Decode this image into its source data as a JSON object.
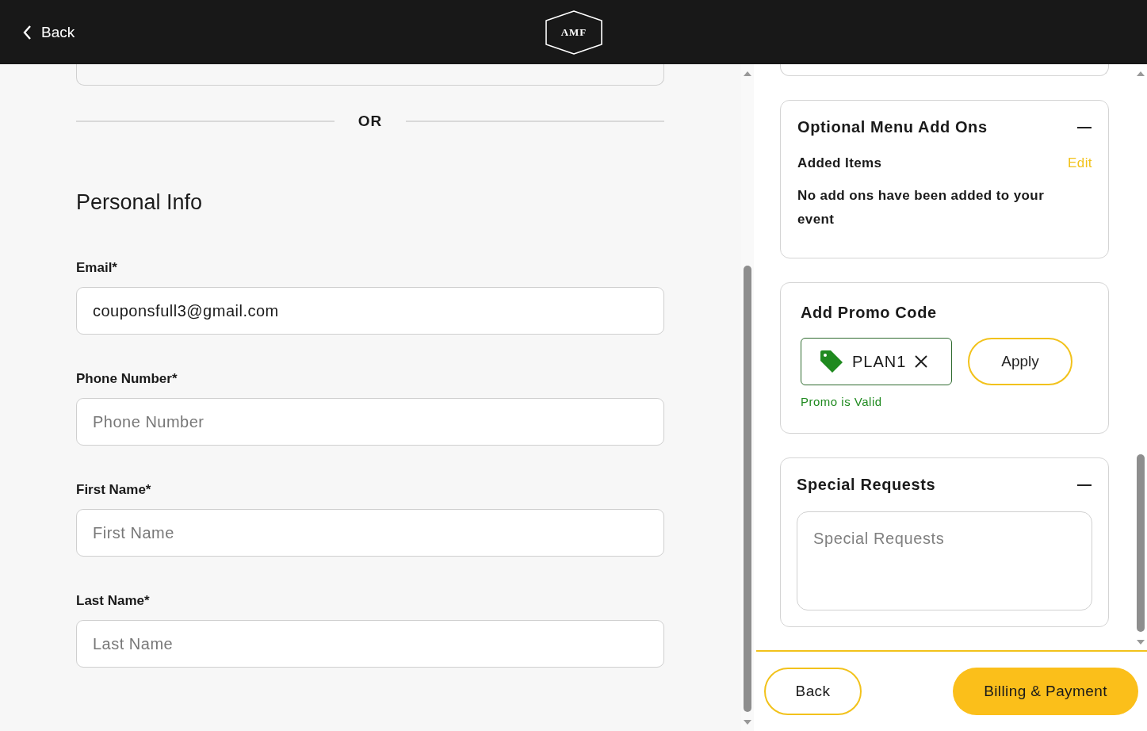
{
  "header": {
    "back": "Back",
    "logo": "AMF"
  },
  "form": {
    "divider_text": "OR",
    "section_title": "Personal Info",
    "fields": [
      {
        "label": "Email*",
        "value": "couponsfull3@gmail.com"
      },
      {
        "label": "Phone Number*",
        "placeholder": "Phone Number"
      },
      {
        "label": "First Name*",
        "placeholder": "First Name"
      },
      {
        "label": "Last Name*",
        "placeholder": "Last Name"
      }
    ]
  },
  "summary": {
    "cards": [
      {
        "kind": "addons",
        "title": "Optional Menu Add Ons",
        "expanded": true,
        "subtitle": "Added Items",
        "action": "Edit",
        "message": "No add ons have been added to your event"
      },
      {
        "kind": "promo",
        "title": "Add Promo Code",
        "code": "PLAN1",
        "valid": true,
        "status": "Promo is Valid",
        "button": "Apply"
      },
      {
        "kind": "requests",
        "title": "Special Requests",
        "expanded": true,
        "placeholder": "Special Requests"
      }
    ]
  },
  "footer": {
    "back": "Back",
    "next": "Billing & Payment"
  }
}
